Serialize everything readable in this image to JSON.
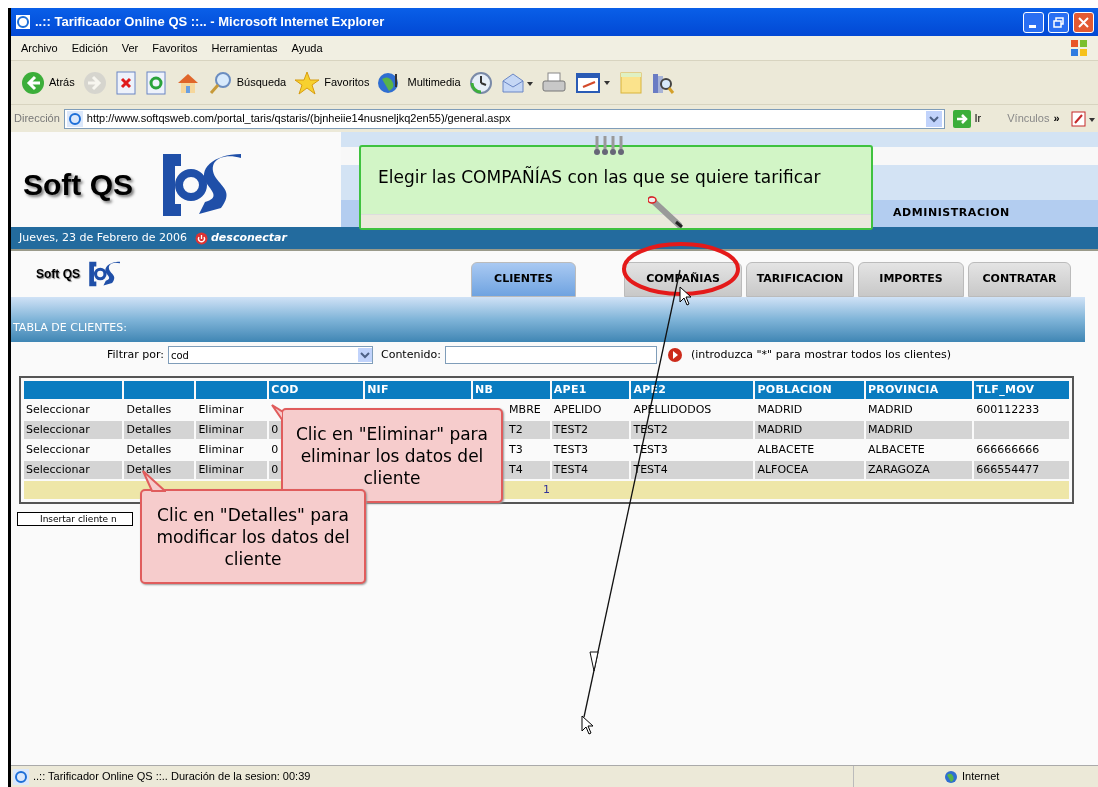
{
  "window": {
    "title": "..:: Tarificador Online QS ::.. - Microsoft Internet Explorer"
  },
  "menu": [
    "Archivo",
    "Edición",
    "Ver",
    "Favoritos",
    "Herramientas",
    "Ayuda"
  ],
  "toolbar": [
    {
      "kind": "back",
      "label": "Atrás",
      "disabled": false
    },
    {
      "kind": "forward",
      "disabled": true
    },
    {
      "kind": "stop"
    },
    {
      "kind": "refresh"
    },
    {
      "kind": "home"
    },
    {
      "kind": "search",
      "label": "Búsqueda"
    },
    {
      "kind": "favorites",
      "label": "Favoritos"
    },
    {
      "kind": "media",
      "label": "Multimedia"
    },
    {
      "kind": "history"
    },
    {
      "kind": "mail"
    },
    {
      "kind": "print"
    },
    {
      "kind": "edit"
    },
    {
      "kind": "note"
    },
    {
      "kind": "research"
    }
  ],
  "address": {
    "label": "Dirección",
    "value": "http://www.softqsweb.com/portal_taris/qstaris/(bjnheiie14nusneljkq2en55)/general.aspx",
    "go": "Ir",
    "links": "Vínculos",
    "links_more": "»"
  },
  "header": {
    "logo": "Soft QS",
    "section": "ADMINISTRACION",
    "date": "Jueves, 23 de Febrero de 2006",
    "logout": "desconectar",
    "small_logo": "Soft QS"
  },
  "tabs": [
    {
      "label": "CLIENTES",
      "selected": true
    },
    {
      "label": "COMPAÑIAS",
      "selected": false
    },
    {
      "label": "TARIFICACION",
      "selected": false
    },
    {
      "label": "IMPORTES",
      "selected": false
    },
    {
      "label": "CONTRATAR",
      "selected": false
    }
  ],
  "section_title": "TABLA DE CLIENTES:",
  "filter": {
    "label": "Filtrar por:",
    "value": "cod",
    "content_label": "Contenido:",
    "hint": "(introduzca \"*\" para mostrar todos los clientes)"
  },
  "table": {
    "columns": [
      "",
      "",
      "",
      "COD",
      "NIF",
      "NB",
      "APE1",
      "APE2",
      "POBLACION",
      "PROVINCIA",
      "TLF_MOV"
    ],
    "rows": [
      [
        "Seleccionar",
        "Detalles",
        "Eliminar",
        "",
        "",
        "MBRE",
        "APELIDO",
        "APELLIDODOS",
        "MADRID",
        "MADRID",
        "600112233"
      ],
      [
        "Seleccionar",
        "Detalles",
        "Eliminar",
        "0",
        "",
        "T2",
        "TEST2",
        "TEST2",
        "MADRID",
        "MADRID",
        ""
      ],
      [
        "Seleccionar",
        "Detalles",
        "Eliminar",
        "0",
        "",
        "T3",
        "TEST3",
        "TEST3",
        "ALBACETE",
        "ALBACETE",
        "666666666"
      ],
      [
        "Seleccionar",
        "Detalles",
        "Eliminar",
        "0",
        "",
        "T4",
        "TEST4",
        "TEST4",
        "ALFOCEA",
        "ZARAGOZA",
        "666554477"
      ]
    ],
    "pager": "1"
  },
  "insert_button": "Insertar cliente n",
  "callouts": [
    {
      "kind": "note",
      "text": "Elegir las COMPAÑÍAS con las que se quiere tarificar"
    },
    {
      "kind": "bubble",
      "text": "Clic en \"Eliminar\" para eliminar los datos del cliente"
    },
    {
      "kind": "bubble",
      "text": "Clic en \"Detalles\" para modificar los datos del cliente"
    }
  ],
  "status_bar": {
    "text": "..:: Tarificador Online QS ::.. Duración de la sesion: 00:39",
    "zone": "Internet"
  }
}
